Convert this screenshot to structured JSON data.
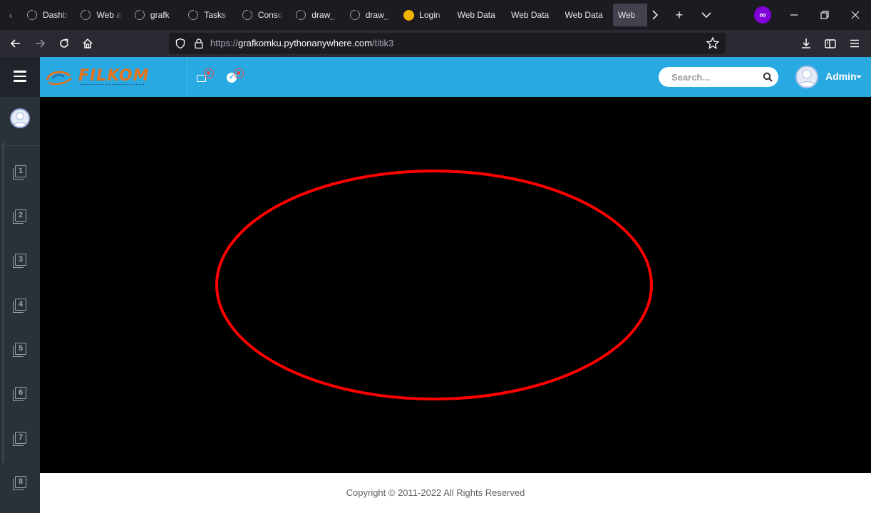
{
  "browser": {
    "tabs": [
      {
        "label": "Dashb",
        "icon": "globe-icon"
      },
      {
        "label": "Web a",
        "icon": "globe-icon"
      },
      {
        "label": "grafk",
        "icon": "globe-icon"
      },
      {
        "label": "Tasks",
        "icon": "globe-icon"
      },
      {
        "label": "Conso",
        "icon": "globe-icon"
      },
      {
        "label": "draw_",
        "icon": "globe-icon"
      },
      {
        "label": "draw_",
        "icon": "globe-icon"
      },
      {
        "label": "Login",
        "icon": "emoji-icon"
      },
      {
        "label": "Web Data",
        "icon": ""
      },
      {
        "label": "Web Data",
        "icon": ""
      },
      {
        "label": "Web Data",
        "icon": ""
      },
      {
        "label": "Web D",
        "icon": "",
        "active": true,
        "close": "×"
      }
    ],
    "new_tab_symbol": "+",
    "private_symbol": "∞",
    "url_prefix": "https://",
    "url_host": "grafkomku.pythonanywhere.com",
    "url_path": "/titik3"
  },
  "app": {
    "logo_text_1": "FIL",
    "logo_text_2": "KOM",
    "search_placeholder": "Search...",
    "user_name": "Admin",
    "sidebar_items": [
      "1",
      "2",
      "3",
      "4",
      "5",
      "6",
      "7",
      "8"
    ],
    "footer_text": "Copyright © 2011-2022 All Rights Reserved"
  },
  "drawing": {
    "shape": "ellipse",
    "stroke_color": "#ff0000",
    "background_color": "#000000"
  },
  "colors": {
    "topbar": "#29a9e1",
    "sidebar": "#2b3138",
    "browser_chrome": "#1c1b22"
  }
}
